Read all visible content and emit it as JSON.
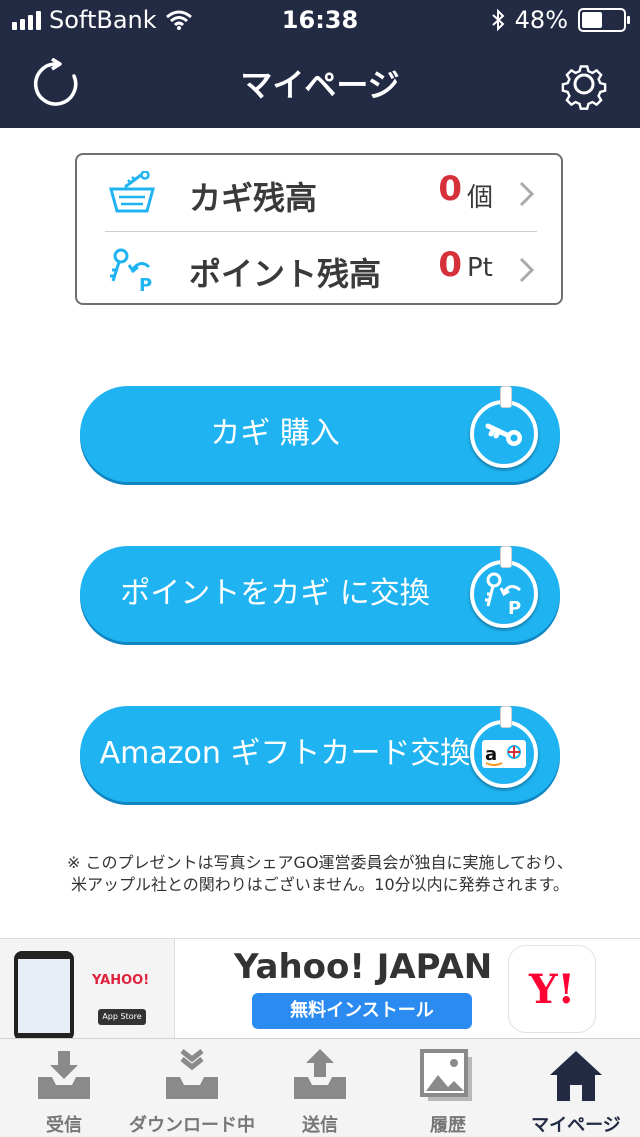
{
  "status_bar": {
    "carrier": "SoftBank",
    "time": "16:38",
    "battery": "48%"
  },
  "nav": {
    "title": "マイページ"
  },
  "balances": [
    {
      "label": "カギ残高",
      "value": "0",
      "unit": "個"
    },
    {
      "label": "ポイント残高",
      "value": "0",
      "unit": "Pt"
    }
  ],
  "actions": [
    {
      "label": "カギ 購入"
    },
    {
      "label": "ポイントをカギ に交換"
    },
    {
      "label": "Amazon ギフトカード交換"
    }
  ],
  "note": {
    "line1": "※ このプレゼントは写真シェアGO運営委員会が独自に実施しており、",
    "line2": "米アップル社との関わりはございません。10分以内に発券されます。"
  },
  "ad": {
    "title": "Yahoo! JAPAN",
    "install": "無料インストール",
    "logo_text": "Y!",
    "thumb_logo": "YAHOO!",
    "thumb_store": "App Store"
  },
  "tabs": [
    {
      "label": "受信"
    },
    {
      "label": "ダウンロード中"
    },
    {
      "label": "送信"
    },
    {
      "label": "履歴"
    },
    {
      "label": "マイページ"
    }
  ],
  "colors": {
    "header": "#232b44",
    "accent": "#1fb4f1",
    "value": "#d6303a"
  },
  "icons": [
    "refresh-icon",
    "gear-icon",
    "basket-key-icon",
    "key-point-icon",
    "chevron-right-icon",
    "key-icon",
    "amazon-icon",
    "inbox-download-icon",
    "upload-icon",
    "gallery-icon",
    "home-icon"
  ]
}
